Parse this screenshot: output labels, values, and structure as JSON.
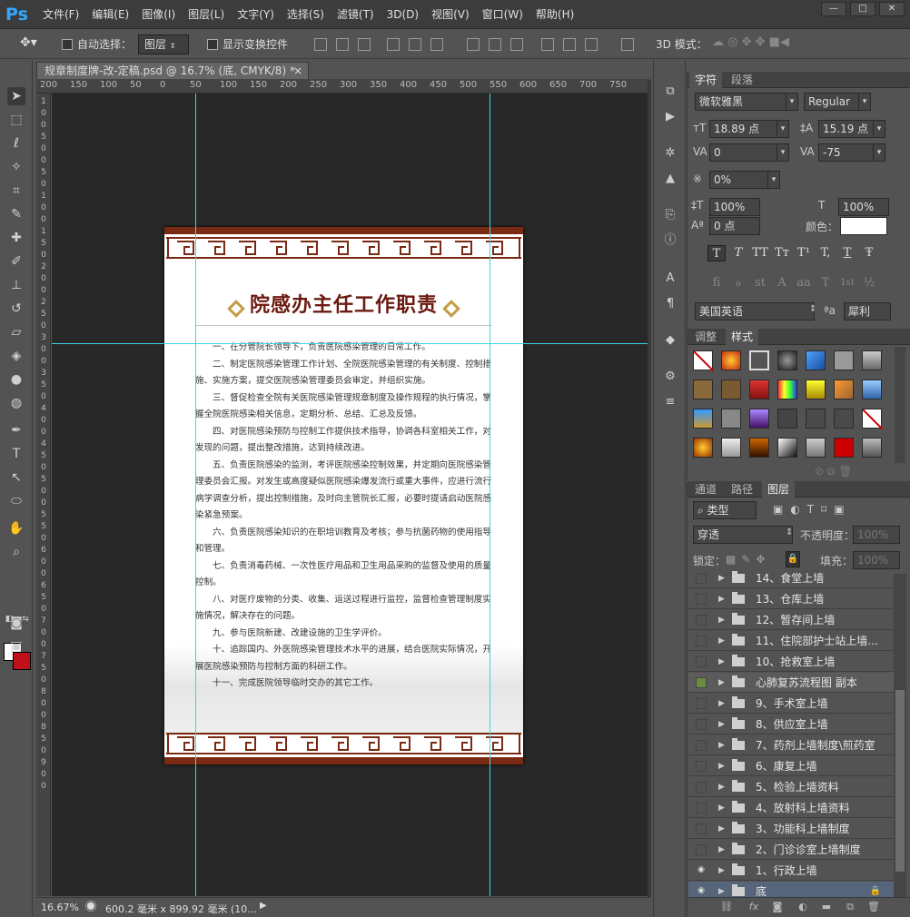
{
  "app": {
    "logo": "Ps",
    "min": "—",
    "max": "□",
    "close": "✕"
  },
  "menu": [
    "文件(F)",
    "编辑(E)",
    "图像(I)",
    "图层(L)",
    "文字(Y)",
    "选择(S)",
    "滤镜(T)",
    "3D(D)",
    "视图(V)",
    "窗口(W)",
    "帮助(H)"
  ],
  "options": {
    "auto_select_label": "自动选择：",
    "auto_select_value": "图层",
    "show_transform_label": "显示变换控件",
    "mode_3d_label": "3D 模式："
  },
  "document": {
    "tab_title": "规章制度牌-改-定稿.psd @ 16.7% (底, CMYK/8) *",
    "tab_close": "×",
    "ruler_h": [
      "200",
      "150",
      "100",
      "50",
      "0",
      "50",
      "100",
      "150",
      "200",
      "250",
      "300",
      "350",
      "400",
      "450",
      "500",
      "550",
      "600",
      "650",
      "700",
      "750"
    ],
    "ruler_v": [
      "1",
      "0",
      "0",
      "5",
      "0",
      "0",
      "5",
      "0",
      "1",
      "0",
      "0",
      "1",
      "5",
      "0",
      "2",
      "0",
      "0",
      "2",
      "5",
      "0",
      "3",
      "0",
      "0",
      "3",
      "5",
      "0",
      "4",
      "0",
      "0",
      "4",
      "5",
      "0",
      "5",
      "0",
      "0",
      "5",
      "5",
      "0",
      "6",
      "0",
      "0",
      "6",
      "5",
      "0",
      "7",
      "0",
      "0",
      "7",
      "5",
      "0",
      "8",
      "0",
      "0",
      "8",
      "5",
      "0",
      "9",
      "0",
      "0"
    ],
    "title": "院感办主任工作职责",
    "paragraphs": [
      "一、在分管院长领导下，负责医院感染管理的日常工作。",
      "二、制定医院感染管理工作计划、全院医院感染管理的有关制度、控制措施、实施方案，提交医院感染管理委员会审定，并组织实施。",
      "三、督促检查全院有关医院感染管理规章制度及操作规程的执行情况，掌握全院医院感染相关信息，定期分析、总结、汇总及反馈。",
      "四、对医院感染预防与控制工作提供技术指导，协调各科室相关工作，对发现的问题，提出整改措施，达到持续改进。",
      "五、负责医院感染的监测，考评医院感染控制效果，并定期向医院感染管理委员会汇报。对发生或高度疑似医院感染爆发流行或重大事件，应进行流行病学调查分析，提出控制措施，及时向主管院长汇报，必要时提请启动医院感染紧急预案。",
      "六、负责医院感染知识的在职培训教育及考核；参与抗菌药物的使用指导和管理。",
      "七、负责消毒药械、一次性医疗用品和卫生用品采购的监督及使用的质量控制。",
      "八、对医疗废物的分类、收集、运送过程进行监控，监督检查管理制度实施情况，解决存在的问题。",
      "九、参与医院新建、改建设施的卫生学评价。",
      "十、追踪国内、外医院感染管理技术水平的进展，结合医院实际情况，开展医院感染预防与控制方面的科研工作。",
      "十一、完成医院领导临时交办的其它工作。"
    ]
  },
  "status": {
    "zoom": "16.67%",
    "size": "600.2 毫米 x 899.92 毫米 (10..."
  },
  "char_panel": {
    "tabs": [
      "字符",
      "段落"
    ],
    "font_family": "微软雅黑",
    "font_style": "Regular",
    "font_size": "18.89 点",
    "leading": "15.19 点",
    "kerning": "0",
    "tracking": "-75",
    "scale_pct": "0%",
    "vscale": "100%",
    "hscale": "100%",
    "baseline": "0 点",
    "color_label": "颜色：",
    "language": "美国英语",
    "aa_label": "ªa",
    "aa_value": "犀利",
    "type_buttons": [
      "T",
      "T",
      "TT",
      "Tт",
      "T¹",
      "T,",
      "T",
      "Ŧ"
    ],
    "ot_buttons": [
      "fi",
      "ℴ",
      "st",
      "A",
      "aa",
      "T",
      "1st",
      "½"
    ]
  },
  "styles_panel": {
    "tabs": [
      "调整",
      "样式"
    ]
  },
  "layers_panel": {
    "tabs": [
      "通道",
      "路径",
      "图层"
    ],
    "filter_label": "类型",
    "blend_mode": "穿透",
    "opacity_label": "不透明度：",
    "opacity_value": "100%",
    "lock_label": "锁定：",
    "fill_label": "填充：",
    "fill_value": "100%",
    "layers": [
      {
        "name": "14、食堂上墙",
        "visible": false
      },
      {
        "name": "13、仓库上墙",
        "visible": false
      },
      {
        "name": "12、暂存间上墙",
        "visible": false
      },
      {
        "name": "11、住院部护士站上墙...",
        "visible": false
      },
      {
        "name": "10、抢救室上墙",
        "visible": false
      },
      {
        "name": "心肺复苏流程图 副本",
        "visible": false
      },
      {
        "name": "9、手术室上墙",
        "visible": false
      },
      {
        "name": "8、供应室上墙",
        "visible": false
      },
      {
        "name": "7、药剂上墙制度\\煎药室",
        "visible": false
      },
      {
        "name": "6、康复上墙",
        "visible": false
      },
      {
        "name": "5、检验上墙资料",
        "visible": false
      },
      {
        "name": "4、放射科上墙资料",
        "visible": false
      },
      {
        "name": "3、功能科上墙制度",
        "visible": false
      },
      {
        "name": "2、门诊诊室上墙制度",
        "visible": false
      },
      {
        "name": "1、行政上墙",
        "visible": true
      },
      {
        "name": "底",
        "visible": true
      }
    ],
    "bottom_icons": [
      "link-icon",
      "fx-icon",
      "mask-icon",
      "adjustment-icon",
      "group-icon",
      "new-layer-icon",
      "delete-icon"
    ]
  }
}
